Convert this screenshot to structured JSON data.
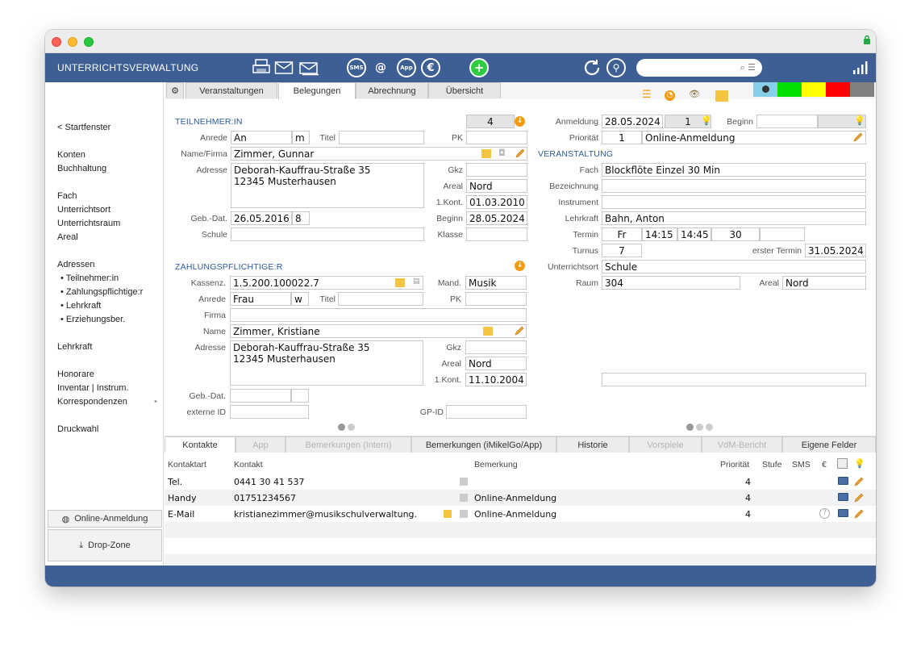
{
  "app": {
    "title": "UNTERRICHTSVERWALTUNG",
    "search": {
      "value": "",
      "placeholder": ""
    },
    "toolbar_icons": [
      "print-icon",
      "mail-icon",
      "mail-open-icon",
      "sms-icon",
      "at-icon",
      "app-icon",
      "euro-icon",
      "add-icon",
      "refresh-icon",
      "search-icon",
      "stats-icon"
    ],
    "accent_color": "#3d5f94"
  },
  "sidebar": {
    "back": "< Startfenster",
    "groups": [
      [
        "Konten",
        "Buchhaltung"
      ],
      [
        "Fach",
        "Unterrichtsort",
        "Unterrichtsraum",
        "Areal"
      ],
      [
        "Adressen"
      ]
    ],
    "address_sub": [
      "• Teilnehmer:in",
      "• Zahlungspflichtige:r",
      "• Lehrkraft",
      "• Erziehungsber."
    ],
    "lehrkraft": "Lehrkraft",
    "honorare": "Honorare",
    "inventar": "Inventar | Instrum.",
    "korrespondenzen": "Korrespondenzen",
    "druckwahl": "Druckwahl",
    "online_anmeldung": "Online-Anmeldung",
    "drop_zone": "Drop-Zone"
  },
  "top_tabs": [
    "Veranstaltungen",
    "Belegungen",
    "Abrechnung",
    "Übersicht"
  ],
  "active_top_tab": "Belegungen",
  "status_colors": [
    "#87ceeb",
    "#00e000",
    "#ffff00",
    "#ff0000",
    "#808080"
  ],
  "teilnehmer": {
    "section": "TEILNEHMER:IN",
    "count": "4",
    "labels": {
      "anrede": "Anrede",
      "titel": "Titel",
      "pk": "PK",
      "name": "Name/Firma",
      "adresse": "Adresse",
      "gkz": "Gkz",
      "areal": "Areal",
      "kont": "1.Kont.",
      "geb": "Geb.-Dat.",
      "beginn": "Beginn",
      "schule": "Schule",
      "klasse": "Klasse"
    },
    "anrede": "An",
    "geschlecht": "m",
    "titel": "",
    "pk": "",
    "name": "Zimmer, Gunnar",
    "adresse1": "Deborah-Kauffrau-Straße 35",
    "adresse2": "12345 Musterhausen",
    "gkz": "",
    "areal": "Nord",
    "kont": "01.03.2010",
    "geb": "26.05.2016",
    "alter": "8",
    "beginn": "28.05.2024",
    "schule": "",
    "klasse": ""
  },
  "zahler": {
    "section": "ZAHLUNGSPFLICHTIGE:R",
    "labels": {
      "kassenz": "Kassenz.",
      "mand": "Mand.",
      "anrede": "Anrede",
      "titel": "Titel",
      "pk": "PK",
      "firma": "Firma",
      "name": "Name",
      "adresse": "Adresse",
      "gkz": "Gkz",
      "areal": "Areal",
      "kont": "1.Kont.",
      "geb": "Geb.-Dat.",
      "extid": "externe ID",
      "gpid": "GP-ID"
    },
    "kassenz": "1.5.200.100022.7",
    "mand": "Musik",
    "anrede": "Frau",
    "geschlecht": "w",
    "titel": "",
    "pk": "",
    "firma": "",
    "name": "Zimmer, Kristiane",
    "adresse1": "Deborah-Kauffrau-Straße 35",
    "adresse2": "12345 Musterhausen",
    "gkz": "",
    "areal": "Nord",
    "kont": "11.10.2004",
    "geb": "",
    "extid": "",
    "gpid": ""
  },
  "anmeldung": {
    "labels": {
      "anmeldung": "Anmeldung",
      "beginn": "Beginn",
      "prioritaet": "Priorität"
    },
    "datum": "28.05.2024",
    "nr": "1",
    "beginn": "",
    "prio": "1",
    "prio_text": "Online-Anmeldung"
  },
  "veranstaltung": {
    "section": "VERANSTALTUNG",
    "labels": {
      "fach": "Fach",
      "bezeichnung": "Bezeichnung",
      "instrument": "Instrument",
      "lehrkraft": "Lehrkraft",
      "termin": "Termin",
      "turnus": "Turnus",
      "erster": "erster Termin",
      "ort": "Unterrichtsort",
      "raum": "Raum",
      "areal": "Areal"
    },
    "fach": "Blockflöte Einzel 30 Min",
    "bezeichnung": "",
    "instrument": "",
    "lehrkraft": "Bahn, Anton",
    "tag": "Fr",
    "von": "14:15",
    "bis": "14:45",
    "dauer": "30",
    "turnus": "7",
    "erster": "31.05.2024",
    "ort": "Schule",
    "raum": "304",
    "areal": "Nord"
  },
  "bottom_tabs": [
    "Kontakte",
    "App",
    "Bemerkungen (Intern)",
    "Bemerkungen (iMikelGo/App)",
    "Historie",
    "Vorspiele",
    "VdM-Bericht",
    "Eigene Felder"
  ],
  "active_bottom_tab": "Kontakte",
  "contacts": {
    "headers": {
      "art": "Kontaktart",
      "kontakt": "Kontakt",
      "bemerkung": "Bemerkung",
      "prio": "Priorität",
      "stufe": "Stufe",
      "sms": "SMS",
      "euro": "€"
    },
    "rows": [
      {
        "art": "Tel.",
        "kontakt": "0441 30 41 537",
        "bemerkung": "",
        "prio": "4"
      },
      {
        "art": "Handy",
        "kontakt": "01751234567",
        "bemerkung": "Online-Anmeldung",
        "prio": "4"
      },
      {
        "art": "E-Mail",
        "kontakt": "kristianezimmer@musikschulverwaltung.",
        "bemerkung": "Online-Anmeldung",
        "prio": "4"
      }
    ]
  }
}
